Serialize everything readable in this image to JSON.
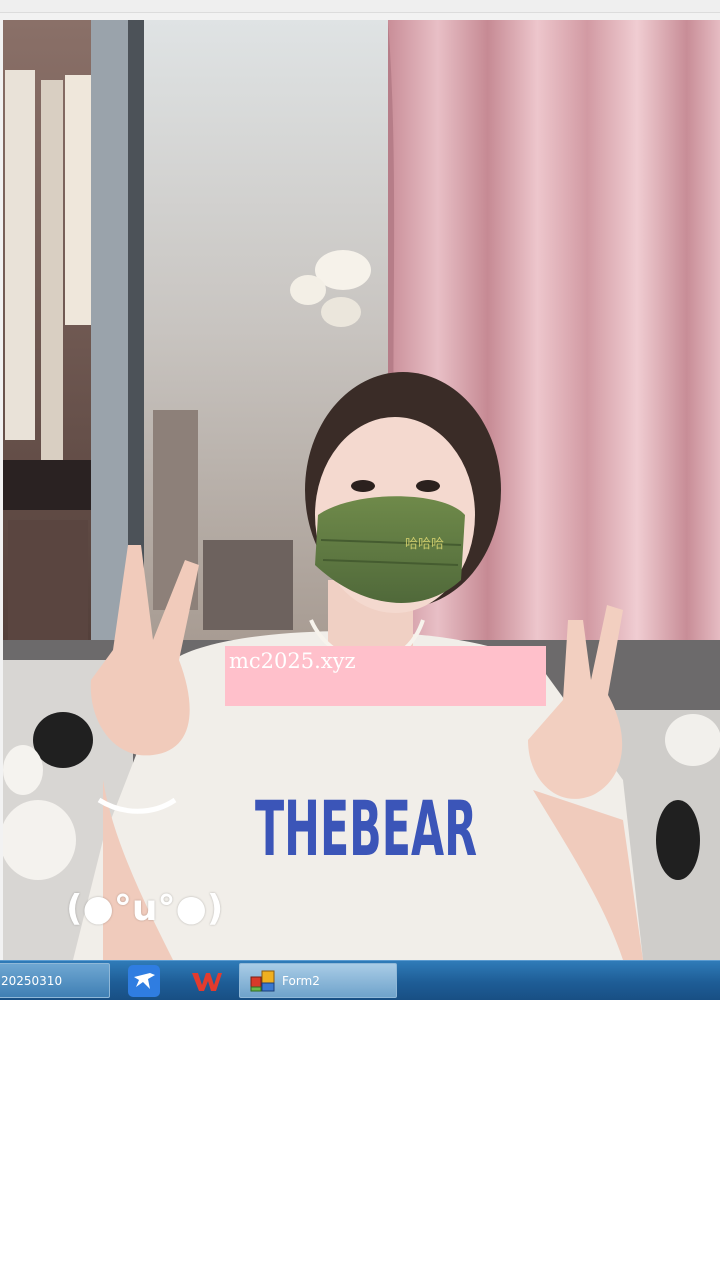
{
  "photo": {
    "watermark_text": "mc2025.xyz",
    "shirt_text": "THEBEAR",
    "emoticon_text": "(●°u°●)"
  },
  "taskbar": {
    "items": [
      {
        "label": "20250310",
        "icon": "window-icon"
      },
      {
        "label": "",
        "icon": "bird-app-icon"
      },
      {
        "label": "",
        "icon": "wps-office-icon"
      },
      {
        "label": "Form2",
        "icon": "form-app-icon"
      }
    ]
  },
  "colors": {
    "watermark_bg": "#ffc0cb",
    "taskbar": "#1e5d96",
    "shirt_text": "#3b55b8",
    "mask": "#5f7a3e"
  }
}
